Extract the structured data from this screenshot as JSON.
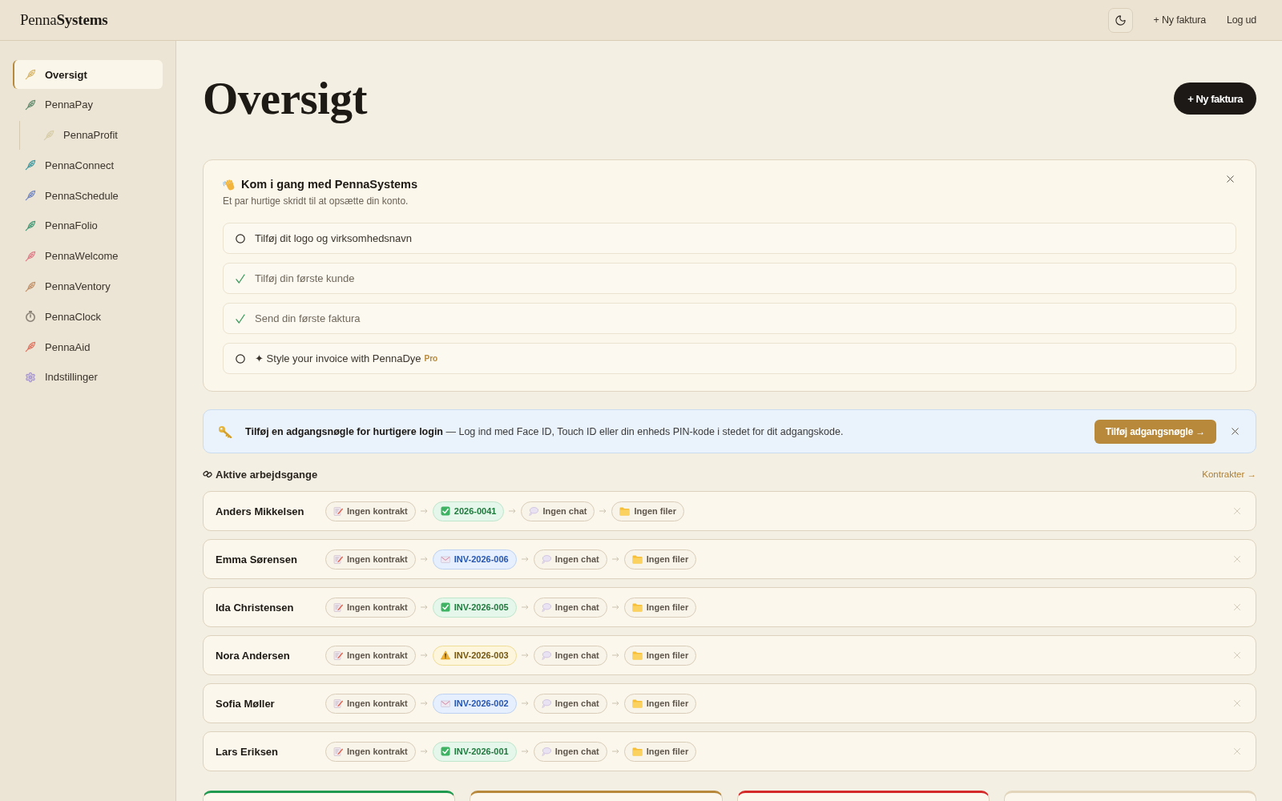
{
  "header": {
    "logo": "Penna**Systems**",
    "links": [
      "+ Ny faktura",
      "Log ud"
    ]
  },
  "sidebar": {
    "items": [
      {
        "label": "Oversigt",
        "kind": "app",
        "color": "#d6b466",
        "selected": true
      },
      {
        "label": "PennaPay",
        "kind": "app",
        "color": "#5f8a6c",
        "selected": false,
        "children": [
          {
            "label": "PennaProfit",
            "kind": "app",
            "color": "#d6cca8",
            "selected": false
          }
        ]
      },
      {
        "label": "PennaConnect",
        "kind": "app",
        "color": "#3b98a0",
        "selected": false
      },
      {
        "label": "PennaSchedule",
        "kind": "app",
        "color": "#6e84c2",
        "selected": false
      },
      {
        "label": "PennaFolio",
        "kind": "app",
        "color": "#3d9873",
        "selected": false
      },
      {
        "label": "PennaWelcome",
        "kind": "app",
        "color": "#e07886",
        "selected": false
      },
      {
        "label": "PennaVentory",
        "kind": "app",
        "color": "#c08f66",
        "selected": false
      },
      {
        "label": "PennaClock",
        "kind": "timer",
        "color": "#8b8377",
        "selected": false
      },
      {
        "label": "PennaAid",
        "kind": "app",
        "color": "#e06f5c",
        "selected": false
      },
      {
        "label": "Indstillinger",
        "kind": "settings",
        "color": "#a393d2",
        "selected": false
      }
    ]
  },
  "page": {
    "title": "Oversigt",
    "primary_button": "+ Ny faktura"
  },
  "onboarding": {
    "title": "Kom i gang med PennaSystems",
    "subtitle": "Et par hurtige skridt til at opsætte din konto.",
    "steps": [
      {
        "label": "Tilføj dit logo og virksomhedsnavn",
        "done": false
      },
      {
        "label": "Tilføj din første kunde",
        "done": true
      },
      {
        "label": "Send din første faktura",
        "done": true
      },
      {
        "label": "✦ Style your invoice with PennaDye",
        "done": false,
        "tag": "Pro"
      }
    ]
  },
  "passkey_banner": {
    "message": "**Tilføj en adgangsnøgle for hurtigere login** — Log ind med Face ID, Touch ID eller din enheds PIN-kode i stedet for dit adgangskode.",
    "button": "Tilføj adgangsnøgle →"
  },
  "workflows": {
    "title": "Aktive arbejdsgange",
    "link": "Kontrakter →",
    "rows": [
      {
        "name": "Anders Mikkelsen",
        "steps": [
          {
            "kind": "contract",
            "label": "Ingen kontrakt"
          },
          {
            "kind": "invoice",
            "label": "2026-0041",
            "paid": true,
            "overdue": false
          },
          {
            "kind": "chat",
            "label": "Ingen chat"
          },
          {
            "kind": "files",
            "label": "Ingen filer"
          }
        ]
      },
      {
        "name": "Emma Sørensen",
        "steps": [
          {
            "kind": "contract",
            "label": "Ingen kontrakt"
          },
          {
            "kind": "invoice",
            "label": "INV-2026-006",
            "paid": false,
            "overdue": false
          },
          {
            "kind": "chat",
            "label": "Ingen chat"
          },
          {
            "kind": "files",
            "label": "Ingen filer"
          }
        ]
      },
      {
        "name": "Ida Christensen",
        "steps": [
          {
            "kind": "contract",
            "label": "Ingen kontrakt"
          },
          {
            "kind": "invoice",
            "label": "INV-2026-005",
            "paid": true,
            "overdue": false
          },
          {
            "kind": "chat",
            "label": "Ingen chat"
          },
          {
            "kind": "files",
            "label": "Ingen filer"
          }
        ]
      },
      {
        "name": "Nora Andersen",
        "steps": [
          {
            "kind": "contract",
            "label": "Ingen kontrakt"
          },
          {
            "kind": "invoice",
            "label": "INV-2026-003",
            "paid": false,
            "overdue": true
          },
          {
            "kind": "chat",
            "label": "Ingen chat"
          },
          {
            "kind": "files",
            "label": "Ingen filer"
          }
        ]
      },
      {
        "name": "Sofia Møller",
        "steps": [
          {
            "kind": "contract",
            "label": "Ingen kontrakt"
          },
          {
            "kind": "invoice",
            "label": "INV-2026-002",
            "paid": false,
            "overdue": false
          },
          {
            "kind": "chat",
            "label": "Ingen chat"
          },
          {
            "kind": "files",
            "label": "Ingen filer"
          }
        ]
      },
      {
        "name": "Lars Eriksen",
        "steps": [
          {
            "kind": "contract",
            "label": "Ingen kontrakt"
          },
          {
            "kind": "invoice",
            "label": "INV-2026-001",
            "paid": true,
            "overdue": false
          },
          {
            "kind": "chat",
            "label": "Ingen chat"
          },
          {
            "kind": "files",
            "label": "Ingen filer"
          }
        ]
      }
    ]
  },
  "summary_cards": [
    {
      "color": "#1f9a4f"
    },
    {
      "color": "#b8893a"
    },
    {
      "color": "#d42a2a"
    },
    {
      "color": "#e2d5ba"
    }
  ]
}
